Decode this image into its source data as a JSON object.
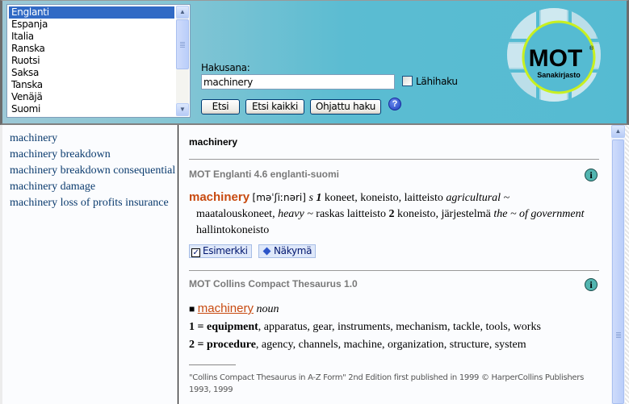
{
  "languages": {
    "items": [
      "Englanti",
      "Espanja",
      "Italia",
      "Ranska",
      "Ruotsi",
      "Saksa",
      "Tanska",
      "Venäjä",
      "Suomi"
    ],
    "selected": "Englanti"
  },
  "search": {
    "label": "Hakusana:",
    "value": "machinery",
    "near_search_label": "Lähihaku",
    "near_search_checked": false,
    "buttons": {
      "search": "Etsi",
      "search_all": "Etsi kaikki",
      "guided_search": "Ohjattu haku"
    },
    "help_icon": "?"
  },
  "logo": {
    "brand": "MOT",
    "registered": "®",
    "subtitle": "Sanakirjasto",
    "colors": {
      "ring": "#c8f020",
      "background": "#55bbd2"
    }
  },
  "word_list": [
    "machinery",
    "machinery breakdown",
    "machinery breakdown consequential",
    "machinery damage",
    "machinery loss of profits insurance"
  ],
  "result": {
    "headword": "machinery",
    "dictionaries": [
      {
        "title": "MOT Englanti 4.6 englanti-suomi",
        "entry": {
          "headword": "machinery",
          "pronunciation": "[məˈʃiːnəri]",
          "pos": "s",
          "sense1_num": "1",
          "sense1_text": "koneet, koneisto, laitteisto",
          "ex1_en": "agricultural ~",
          "ex1_fi": "maatalouskoneet,",
          "ex2_en": "heavy ~",
          "ex2_fi": "raskas laitteisto",
          "sense2_num": "2",
          "sense2_text": "koneisto, järjestelmä",
          "ex3_en": "the ~ of government",
          "ex3_fi": "hallintokoneisto"
        },
        "buttons": {
          "examples": "Esimerkki",
          "examples_checked": true,
          "view": "Näkymä"
        }
      },
      {
        "title": "MOT Collins Compact Thesaurus 1.0",
        "entry": {
          "bullet": "■",
          "headword": "machinery",
          "pos": "noun",
          "senses": [
            {
              "num": "1 =",
              "key": "equipment",
              "synonyms": ", apparatus, gear, instruments, mechanism, tackle, tools, works"
            },
            {
              "num": "2 =",
              "key": "procedure",
              "synonyms": ", agency, channels, machine, organization, structure, system"
            }
          ]
        },
        "footnote": "\"Collins Compact Thesaurus in A-Z Form\" 2nd Edition first published in 1999 © HarperCollins Publishers 1993, 1999"
      }
    ]
  }
}
